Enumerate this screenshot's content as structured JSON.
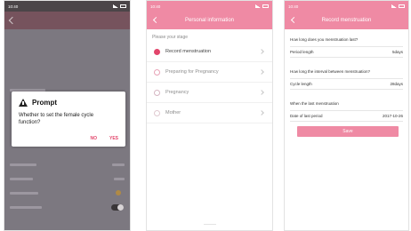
{
  "screen1": {
    "status_time": "10:40",
    "dialog": {
      "title": "Prompt",
      "message": "Whether to set the female cycle function?",
      "no_label": "NO",
      "yes_label": "YES"
    }
  },
  "screen2": {
    "status_time": "10:40",
    "header_title": "Personal information",
    "caption": "Please your stage",
    "stages": [
      {
        "label": "Record menstruation",
        "icon_color": "#e2456b"
      },
      {
        "label": "Preparing for Pregnancy",
        "icon_color": "#e8a3b7"
      },
      {
        "label": "Pregnancy",
        "icon_color": "#d6b6c2"
      },
      {
        "label": "Mother",
        "icon_color": "#e0c9d0"
      }
    ]
  },
  "screen3": {
    "status_time": "10:40",
    "header_title": "Record menstruation",
    "q1": "How long does you menstruation last?",
    "f1_label": "Period length",
    "f1_value": "5days",
    "q2": "How long the interval between menstruation?",
    "f2_label": "Cycle length",
    "f2_value": "28days",
    "q3": "When the last menstruation",
    "f3_label": "Date of last period",
    "f3_value": "2017-10-26",
    "save_label": "Save"
  },
  "colors": {
    "accent_pink": "#ef8aa4",
    "dialog_button": "#e2456b"
  }
}
